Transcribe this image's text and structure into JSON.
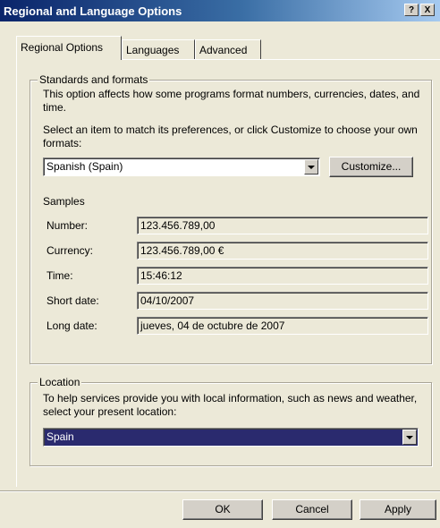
{
  "window": {
    "title": "Regional and Language Options",
    "help_button": "?",
    "close_button": "X"
  },
  "tabs": [
    {
      "label": "Regional Options",
      "active": true
    },
    {
      "label": "Languages",
      "active": false
    },
    {
      "label": "Advanced",
      "active": false
    }
  ],
  "standards": {
    "legend": "Standards and formats",
    "description": "This option affects how some programs format numbers, currencies, dates, and time.",
    "instruction": "Select an item to match its preferences, or click Customize to choose your own formats:",
    "format_value": "Spanish (Spain)",
    "customize_label": "Customize...",
    "samples_heading": "Samples",
    "samples": [
      {
        "label": "Number:",
        "value": "123.456.789,00"
      },
      {
        "label": "Currency:",
        "value": "123.456.789,00 €"
      },
      {
        "label": "Time:",
        "value": "15:46:12"
      },
      {
        "label": "Short date:",
        "value": "04/10/2007"
      },
      {
        "label": "Long date:",
        "value": "jueves, 04 de octubre de 2007"
      }
    ]
  },
  "location": {
    "legend": "Location",
    "description": "To help services provide you with local information, such as news and weather, select your present location:",
    "value": "Spain"
  },
  "footer": {
    "ok_label": "OK",
    "cancel_label": "Cancel",
    "apply_label": "Apply"
  }
}
